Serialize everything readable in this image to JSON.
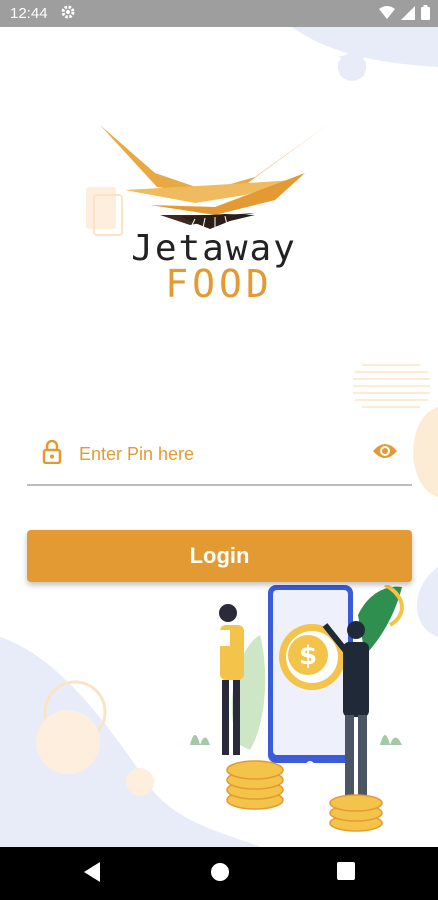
{
  "status_bar": {
    "time": "12:44",
    "icons": [
      "gear-icon",
      "wifi-icon",
      "signal-icon",
      "battery-icon"
    ]
  },
  "brand": {
    "name_line1": "Jetaway",
    "name_line2": "FOOD",
    "accent_color": "#e39a33",
    "text_color": "#222222"
  },
  "form": {
    "pin_placeholder": "Enter Pin here",
    "pin_value": "",
    "lock_icon": "lock-icon",
    "visibility_icon": "eye-icon"
  },
  "actions": {
    "login_label": "Login"
  },
  "nav_bar": {
    "buttons": [
      "back-icon",
      "home-icon",
      "recents-icon"
    ]
  },
  "colors": {
    "primary": "#e39a33",
    "status_bar": "#9e9e9e",
    "nav_bar": "#000000",
    "decor_blue": "#e8ecf8"
  }
}
